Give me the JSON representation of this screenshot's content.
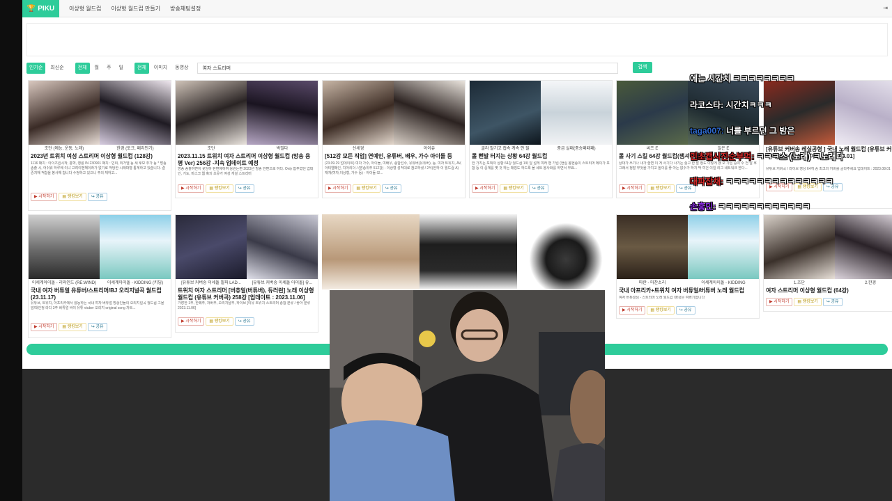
{
  "navbar": {
    "brand": "PIKU",
    "links": [
      "이상형 월드컵",
      "이상형 월드컵 만들기",
      "방송채팅설정"
    ],
    "right_icon": "logout-icon"
  },
  "filters": {
    "sort": [
      "인기순",
      "최신순"
    ],
    "period": [
      "전체",
      "월",
      "주",
      "일"
    ],
    "media": [
      "전체",
      "이미지",
      "동영상"
    ],
    "search_value": "여자 스트리머",
    "search_button": "검색"
  },
  "buttons": {
    "start": "▶ 시작하기",
    "rank": "▤ 랭킹보기",
    "share": "↪ 공유"
  },
  "cards": [
    {
      "cap1": "조단 (예능, 운동, 노래)",
      "cap2": "한경 (토크, 패리인기)",
      "title": "2023년 트위치 여성 스트리머 이상형 월드컵 (128강)",
      "desc": "1116 패치 : 아이즈원시작, 홍혁, 영롱 IN 230901 패치 : 민희, 최가엘 등 새 후보 추가 등 * 방송 송출 시, 어쉬워 하루에 이냐 고려이벤해이라가 없기로 적당한 시래파형 통계하고 있습니다. 결 중치해 적합을 봉사해 합니다 수정하고 있으니 주의 체하고..."
    },
    {
      "cap1": "조단",
      "cap2": "박빌다",
      "title": "2023.11.15 트위치 여자 스트리머 이상형 월드컵 (방송 용 평 Ver) 256강 -지속 업데이트 예정",
      "desc": "방송 송출하면이 꽃당하 된편에하여 응원는편 2023년 방송 한편으로 하다. Only 합주었던 업데인, 기도, 마스크 웹 혹의 초유가 여성 개설 스트리머"
    },
    {
      "cap1": "신세경",
      "cap2": "아이유",
      "title": "[512강 모든 직업] 연예인, 유튜버, 배우, 가수 아이돌 등",
      "desc": "(23.09.29 업데이트) 여자 가수, 아이돌, 여배우, 종합선수, 유튜버(유튜버), 등, 여자 트위치, AV, 아티엘메인, 치어리더 / (방송위주 512강) - 이상형 성적대로 참고하셨 / 2석(한하 이 월드컵 A) 재개(여자,이상형, 가수 등) - 아이돌-모..."
    },
    {
      "cap1": "골라 말기고 접속 계속 안 될",
      "cap2": "중급 실패(중승패패패)",
      "title": "롤 뻔발 터지는 상황 64강 월드컵",
      "desc": "한 가지는 포획의 상황 64강 월드컵 1회 달 설게 여러 밴 가입 (현실 봉현송이 스트리머 메이가 포함 등 이 중계를 몇 것 하는 매칭도 하드록 몰 세트 봉사화를 하면서 무효..."
    },
    {
      "cap1": "씨즈 E",
      "cap2": "일은 E",
      "title": "롤 사기 스킬 64강 월드컵(잼셔 바쁜)",
      "desc": "상대가 쓰기나 내가 쓸면 이 게 사기다 사기는 싫고 한 발 정도 이렇게 했 오 가는 중이 수 전 달 후 그래서 정말 무엇을 가지고 놀이를 좋 아는 없수가 하지 막 여건 이일 리그 네트워크 한다..."
    },
    {
      "cap1": "1.조단",
      "cap2": "2.한경",
      "title": "[유튜브 커버송 레실공형 ] 국내 노래 월드컵 (유튜브 커버곡/라이브) 64강 [업데이트 : 2023.08.01]",
      "desc": "유튜브 커버곡 / 라이브 영상 64개 중 최고의 커버를 골라주세요 업데이트 : 2023.08.01"
    },
    {
      "cap1": "이세계아이돌 - 리와인드 (RE:WIND)",
      "cap2": "이세계아이돌 - KIDDING (키딩)",
      "title": "국내 여자 버튜얼 유튜버/스트리머/BJ 오리지널곡 월드컵 (23.11.17)",
      "desc": "유튜브, 트위치, 아프리카에서 활동하는 국내 여자 버튜얼 방송인들의 오리지널곡 월드컵 그을 앞/대인정 라디 3주 버튜얼 싸이 유튜 vtuber 오리지 original song 차트..."
    },
    {
      "cap1": "[유튜브 커버송 이세돌 필파 LAD...",
      "cap2": "[유튜브 커버송 이세돌 아이돌] 유...",
      "title": "트위치 여자 스트리머 [버츄얼(버튜버), 듀러런] 노래 이상형 월드컵 (유튜브 커버곡) 258강 [업데이트 : 2023.11.06]",
      "desc": "가장한 1주, 한퀘주, 저버주, 오리지날주, 하이브 [이유 트위치 스트리머 종합 분류 / 좋아 분류 2023.11.06]"
    },
    {
      "cap1": "따란 - 마찬소리",
      "cap2": "이세계아이돌 - KIDDING",
      "title": "국내 아프리카+트위치 여자 버튜얼/버튜버 노래 월드컵",
      "desc": "여자 버튜얼님 - 스트리머 노래 월드컵 /영상은 여쁘기합니다"
    },
    {
      "cap1": "1.조단",
      "cap2": "2.한경",
      "title": "여자 스트리머 이상형 월드컵 (64강)",
      "desc": ""
    }
  ],
  "chat": [
    {
      "name": "",
      "msg": "에는 시간치 ㅋㅋㅋㅋㅋㅋㅋㅋ",
      "color": "#ffffff"
    },
    {
      "name": "라코스타:",
      "msg": "시간치ㅋㅋㅋ",
      "color": "#ffffff"
    },
    {
      "name": "taga007:",
      "msg": "너를 부르던 그 밤은",
      "color": "#2f6bd1"
    },
    {
      "name": "민초캡시진순부먹:",
      "msg": "ㅋㅋㅋ스 (노래) ㅋ노래다",
      "color": "#d42a2a"
    },
    {
      "name": "대파잡채:",
      "msg": "ㅋㅋㅋㅋㅋㅋㅋㅋㅋㅋㅋㅋㅋㅋ",
      "color": "#d42a2a"
    },
    {
      "name": "손흥민:",
      "msg": "ㅋㅋㅋㅋㅋㅋㅋㅋㅋㅋㅋㅋ",
      "color": "#8a2be2"
    }
  ],
  "colors": {
    "accent": "#2ecc9a",
    "page_bg": "#ffffff",
    "frame_bg": "#1a1a1a"
  }
}
